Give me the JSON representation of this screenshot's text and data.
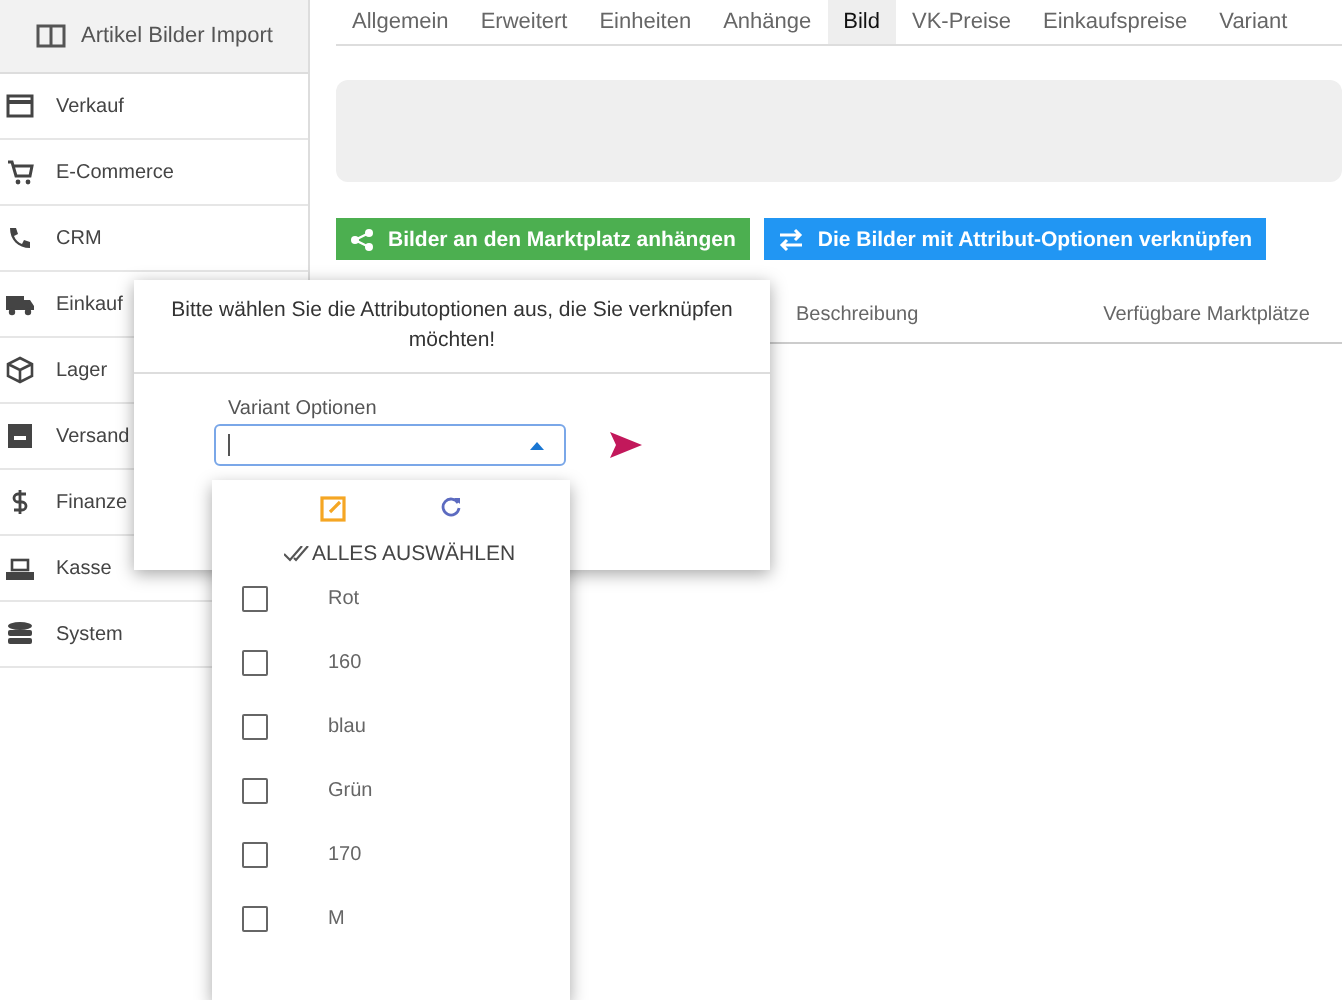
{
  "sidebar": {
    "header": "Artikel Bilder Import",
    "items": [
      {
        "label": "Verkauf"
      },
      {
        "label": "E-Commerce"
      },
      {
        "label": "CRM"
      },
      {
        "label": "Einkauf"
      },
      {
        "label": "Lager"
      },
      {
        "label": "Versand"
      },
      {
        "label": "Finanze"
      },
      {
        "label": "Kasse"
      },
      {
        "label": "System"
      }
    ]
  },
  "tabs": [
    {
      "label": "Allgemein",
      "selected": false
    },
    {
      "label": "Erweitert",
      "selected": false
    },
    {
      "label": "Einheiten",
      "selected": false
    },
    {
      "label": "Anhänge",
      "selected": false
    },
    {
      "label": "Bild",
      "selected": true
    },
    {
      "label": "VK-Preise",
      "selected": false
    },
    {
      "label": "Einkaufspreise",
      "selected": false
    },
    {
      "label": "Variant",
      "selected": false
    }
  ],
  "buttons": [
    {
      "label": "Bilder an den Marktplatz anhängen",
      "kind": "share",
      "color": "#4caf50"
    },
    {
      "label": "Die Bilder mit Attribut-Optionen verknüpfen",
      "kind": "swap",
      "color": "#2196f3"
    }
  ],
  "table": {
    "columns": [
      "Beschreibung",
      "Verfügbare Marktplätze"
    ]
  },
  "dialog": {
    "message": "Bitte wählen Sie die Attributoptionen aus, die Sie verknüpfen möchten!",
    "field_label": "Variant Optionen",
    "select_all": "ALLES AUSWÄHLEN",
    "options": [
      {
        "label": "Rot",
        "checked": false
      },
      {
        "label": "160",
        "checked": false
      },
      {
        "label": "blau",
        "checked": false
      },
      {
        "label": "Grün",
        "checked": false
      },
      {
        "label": "170",
        "checked": false
      },
      {
        "label": "M",
        "checked": false
      }
    ]
  }
}
